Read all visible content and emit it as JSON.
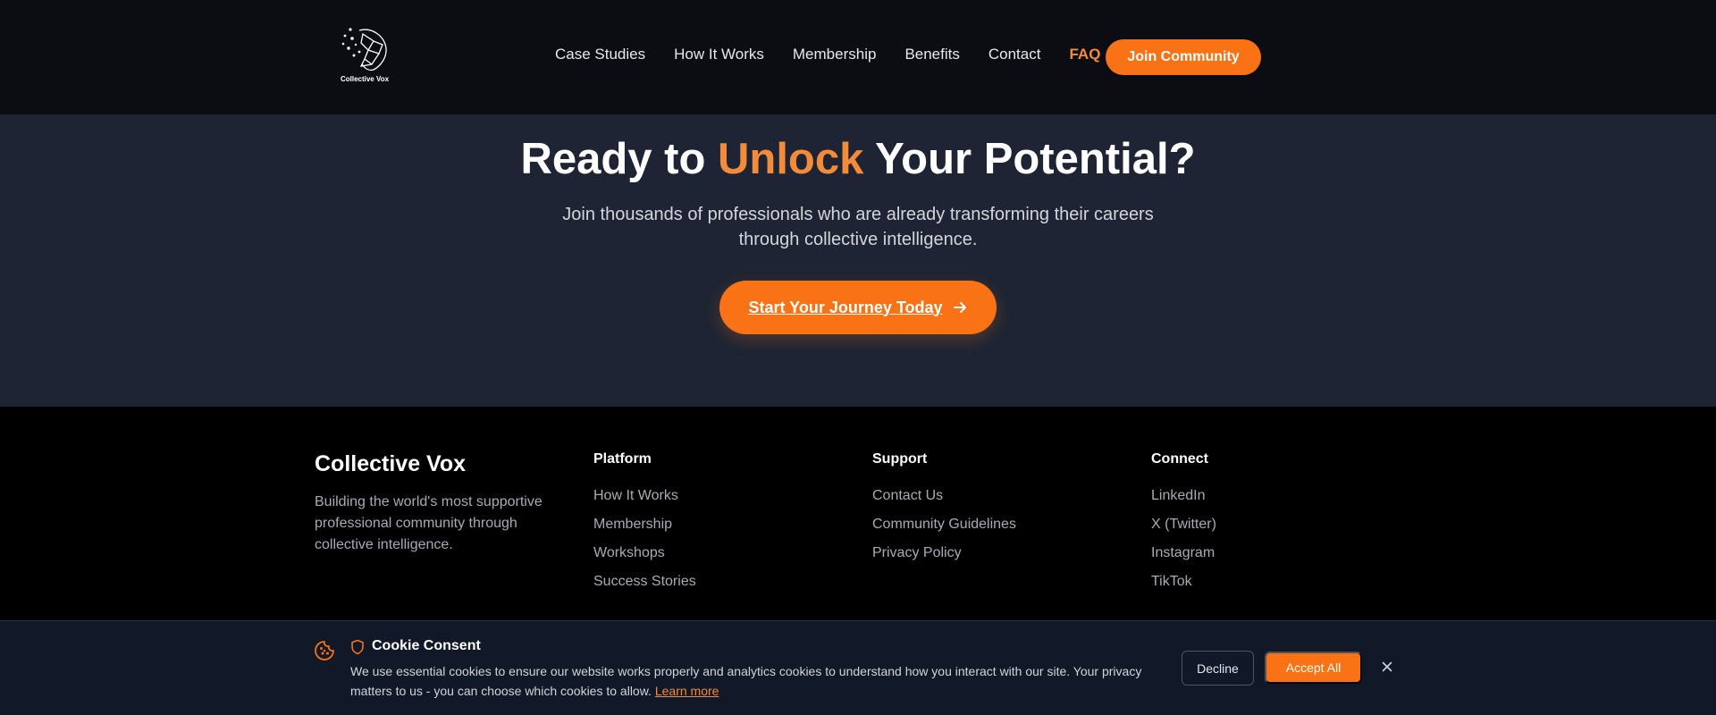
{
  "header": {
    "logo_text": "Collective Vox",
    "nav": [
      "Case Studies",
      "How It Works",
      "Membership",
      "Benefits",
      "Contact",
      "FAQ"
    ],
    "join_label": "Join Community"
  },
  "hero": {
    "title_pre": "Ready to ",
    "title_accent": "Unlock",
    "title_post": " Your Potential?",
    "subtitle": "Join thousands of professionals who are already transforming their careers through collective intelligence.",
    "cta_label": "Start Your Journey Today"
  },
  "footer": {
    "brand": "Collective Vox",
    "description": "Building the world's most supportive professional community through collective intelligence.",
    "columns": [
      {
        "title": "Platform",
        "links": [
          "How It Works",
          "Membership",
          "Workshops",
          "Success Stories"
        ]
      },
      {
        "title": "Support",
        "links": [
          "Contact Us",
          "Community Guidelines",
          "Privacy Policy"
        ]
      },
      {
        "title": "Connect",
        "links": [
          "LinkedIn",
          "X (Twitter)",
          "Instagram",
          "TikTok"
        ]
      }
    ]
  },
  "cookie": {
    "title": "Cookie Consent",
    "text": "We use essential cookies to ensure our website works properly and analytics cookies to understand how you interact with our site. Your privacy matters to us - you can choose which cookies to allow.",
    "learn_more": "Learn more",
    "decline": "Decline",
    "accept": "Accept All"
  },
  "colors": {
    "accent": "#f97316",
    "accent_text": "#f28b3a",
    "header_bg": "#0b0d12",
    "hero_bg": "#1e2433",
    "footer_bg": "#000000",
    "cookie_bg": "#111827"
  },
  "icons": [
    "logo-icon",
    "arrow-right-icon",
    "cookie-icon",
    "shield-icon",
    "close-icon"
  ]
}
